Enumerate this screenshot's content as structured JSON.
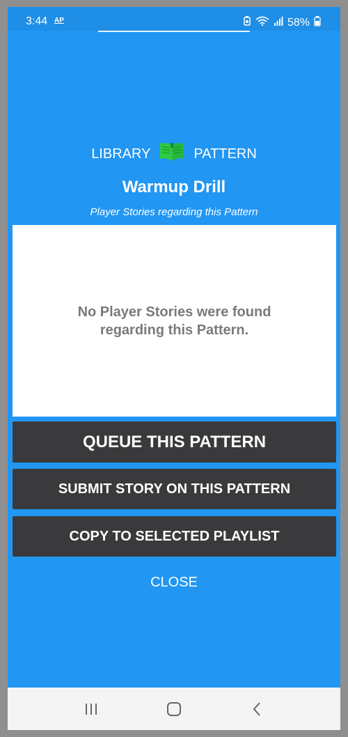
{
  "status_bar": {
    "time": "3:44",
    "ap_badge": "AP",
    "battery": "58%"
  },
  "header": {
    "left_label": "LIBRARY",
    "right_label": "PATTERN",
    "book_icon_color": "#2ecc40",
    "title": "Warmup Drill",
    "subtitle": "Player Stories regarding this Pattern"
  },
  "stories": {
    "empty_message": "No Player Stories were found regarding this Pattern."
  },
  "actions": {
    "queue_label": "QUEUE THIS PATTERN",
    "submit_label": "SUBMIT STORY ON THIS PATTERN",
    "copy_label": "COPY TO SELECTED PLAYLIST",
    "close_label": "CLOSE"
  },
  "colors": {
    "background": "#2196f3",
    "button": "#3a3a3c"
  }
}
